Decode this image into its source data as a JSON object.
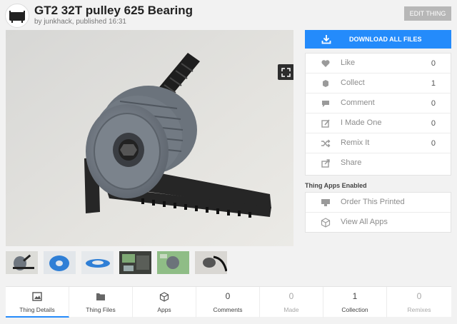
{
  "thing": {
    "title": "GT2 32T pulley 625 Bearing",
    "byline": "by junkhack, published 16:31",
    "edit_label": "EDIT THING"
  },
  "download": {
    "label": "DOWNLOAD ALL FILES",
    "icon": "download-icon"
  },
  "actions": [
    {
      "label": "Like",
      "count": "0",
      "icon": "heart-icon"
    },
    {
      "label": "Collect",
      "count": "1",
      "icon": "collect-icon"
    },
    {
      "label": "Comment",
      "count": "0",
      "icon": "comment-icon"
    },
    {
      "label": "I Made One",
      "count": "0",
      "icon": "made-icon"
    },
    {
      "label": "Remix It",
      "count": "0",
      "icon": "remix-icon"
    },
    {
      "label": "Share",
      "count": "",
      "icon": "share-icon"
    }
  ],
  "apps": {
    "title": "Thing Apps Enabled",
    "items": [
      {
        "label": "Order This Printed",
        "icon": "printer-icon"
      },
      {
        "label": "View All Apps",
        "icon": "cube-icon"
      }
    ]
  },
  "tabs": [
    {
      "label": "Thing Details",
      "num": "",
      "icon": "image-icon"
    },
    {
      "label": "Thing Files",
      "num": "",
      "icon": "folder-icon"
    },
    {
      "label": "Apps",
      "num": "",
      "icon": "cube-icon"
    },
    {
      "label": "Comments",
      "num": "0"
    },
    {
      "label": "Made",
      "num": "0"
    },
    {
      "label": "Collection",
      "num": "1"
    },
    {
      "label": "Remixes",
      "num": "0"
    }
  ],
  "colors": {
    "accent": "#248bfb",
    "edit_button": "#b7b7b7",
    "part": "#7f8791"
  }
}
